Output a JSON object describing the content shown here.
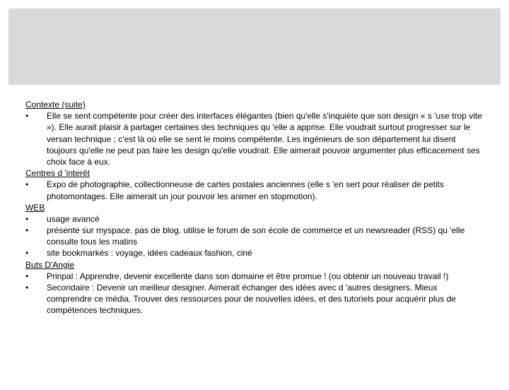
{
  "sections": {
    "contexte": {
      "heading": "Contexte (suite)",
      "items": [
        "Elle se sent compétente pour créer des interfaces élégantes (bien qu'elle s'inquiète que son design « s 'use trop vite »). Elle aurait plaisir à partager certaines des techniques qu 'elle a apprise. Elle voudrait surtout progresser sur le versan technique ; c'est là où elle se sent le moins compétente. Les ingénieurs de son département lui disent toujours qu'elle ne peut pas faire les design qu'elle voudrait. Elle aimerait pouvoir argumenter plus efficacement ses choix face à eux."
      ]
    },
    "centres": {
      "heading": "Centres d 'interêt",
      "items": [
        "Expo de photographie, collectionneuse de cartes postales anciennes (elle s 'en sert pour réaliser de petits photomontages. Elle aimerait un jour pouvoir les animer en stopmotion)."
      ]
    },
    "web": {
      "heading": "WEB",
      "items": [
        "usage avancé",
        "présente sur myspace. pas de blog. utilise le forum de son école de commerce et un newsreader (RSS) qu 'elle consulte tous les matins",
        "site bookmarkés : voyage, idées cadeaux fashion, ciné"
      ]
    },
    "buts": {
      "heading": "Buts D'Angie",
      "items": [
        "Prinpal : Apprendre, devenir excellente dans son domaine et être promue ! (ou obtenir un nouveau travail !)",
        "Secondaire : Devenir un meilleur designer. Aimerait échanger des idées avec d 'autres designers. Mieux comprendre ce média. Trouver des ressources pour de nouvelles idées, et des tutoriels pour acquérir plus de compétences techniques."
      ]
    }
  },
  "bullet_char": "•"
}
